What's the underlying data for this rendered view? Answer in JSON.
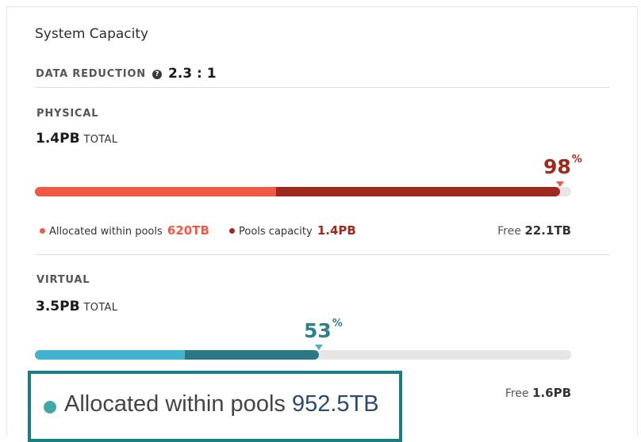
{
  "card": {
    "title": "System Capacity",
    "data_reduction": {
      "label": "DATA REDUCTION",
      "help_icon": "question-circle-icon",
      "value": "2.3 : 1"
    }
  },
  "physical": {
    "label": "PHYSICAL",
    "total_value": "1.4PB",
    "total_unit": "TOTAL",
    "percent": "98",
    "percent_sign": "%",
    "allocated_fraction": 0.45,
    "used_fraction": 0.98,
    "colors": {
      "allocated": "#f05a45",
      "pools": "#9e2a1e",
      "track": "#e6e6e6",
      "percent": "#9e2a1e"
    },
    "legend": [
      {
        "label": "Allocated within pools",
        "value": "620TB",
        "color": "#f05a45"
      },
      {
        "label": "Pools capacity",
        "value": "1.4PB",
        "color": "#9e2a1e"
      }
    ],
    "free_label": "Free",
    "free_value": "22.1TB"
  },
  "virtual": {
    "label": "VIRTUAL",
    "total_value": "3.5PB",
    "total_unit": "TOTAL",
    "percent": "53",
    "percent_sign": "%",
    "allocated_fraction": 0.28,
    "used_fraction": 0.53,
    "colors": {
      "allocated": "#3fb3d0",
      "pools": "#2c7785",
      "track": "#e6e6e6",
      "percent": "#2f7f8c"
    },
    "free_label": "Free",
    "free_value": "1.6PB"
  },
  "callout": {
    "label": "Allocated within pools",
    "value": "952.5TB",
    "dot_color": "#43a8a5",
    "border_color": "#1b7d84"
  }
}
